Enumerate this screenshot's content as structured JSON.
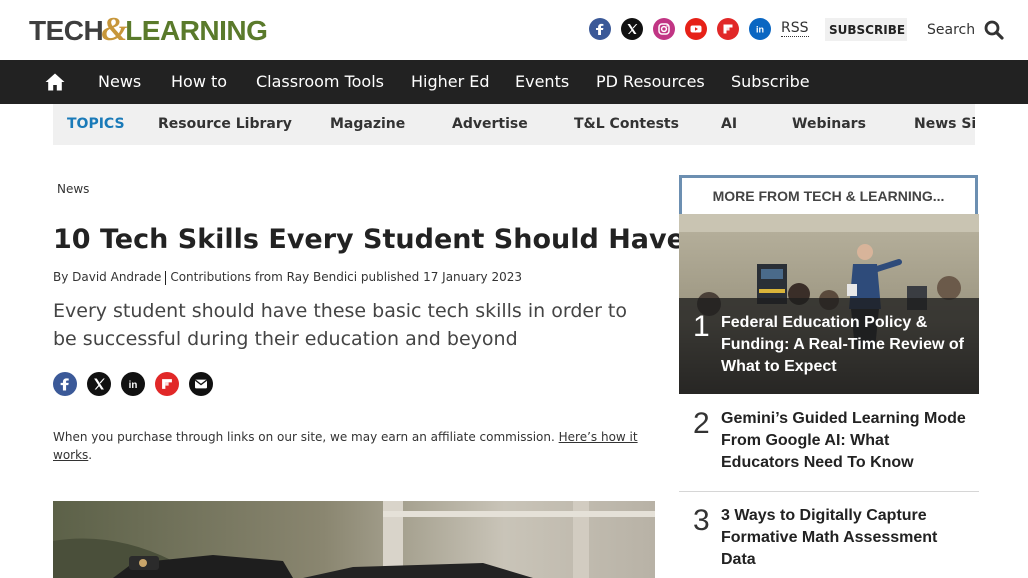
{
  "header": {
    "logo_part1": "TECH",
    "logo_amp": "&",
    "logo_part2": "LEARNING",
    "social_icons": [
      "facebook-icon",
      "x-icon",
      "instagram-icon",
      "youtube-icon",
      "flipboard-icon",
      "linkedin-icon"
    ],
    "rss_label": "RSS",
    "subscribe_label": "SUBSCRIBE",
    "search_label": "Search"
  },
  "nav": {
    "items": [
      "News",
      "How to",
      "Classroom Tools",
      "Higher Ed",
      "Events",
      "PD Resources",
      "Subscribe"
    ]
  },
  "topics": {
    "label": "TOPICS",
    "items": [
      "Resource Library",
      "Magazine",
      "Advertise",
      "T&L Contests",
      "AI",
      "Webinars",
      "News Sig"
    ]
  },
  "article": {
    "breadcrumb": "News",
    "title": "10 Tech Skills Every Student Should Have",
    "byline_author": "By David Andrade",
    "byline_rest": "Contributions from Ray Bendici published 17 January 2023",
    "strapline": "Every student should have these basic tech skills in order to be successful during their education and beyond",
    "affiliate_text": "When you purchase through links on our site, we may earn an affiliate commission.",
    "affiliate_link": "Here’s how it works",
    "affiliate_end": "."
  },
  "sidebar": {
    "heading": "MORE FROM TECH & LEARNING...",
    "items": [
      {
        "num": "1",
        "title": "Federal Education Policy & Funding: A Real-Time Review of What to Expect"
      },
      {
        "num": "2",
        "title": "Gemini’s Guided Learning Mode From Google AI: What Educators Need To Know"
      },
      {
        "num": "3",
        "title": "3 Ways to Digitally Capture Formative Math Assessment Data"
      }
    ]
  },
  "colors": {
    "nav_bg": "#222222",
    "topics_accent": "#1a7ab8",
    "sidebar_border": "#6c8fb1",
    "facebook": "#3b5998",
    "instagram": "#c13584",
    "youtube": "#e62117",
    "flipboard": "#e12828",
    "linkedin": "#0a66c2"
  }
}
